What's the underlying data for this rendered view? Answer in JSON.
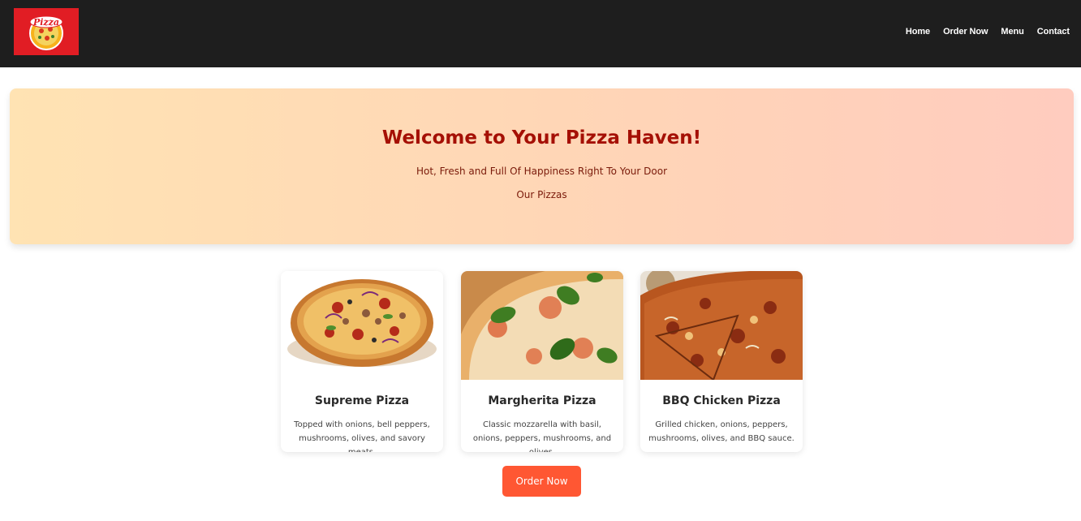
{
  "nav": {
    "logo_text": "Pizza",
    "links": [
      "Home",
      "Order Now",
      "Menu",
      "Contact"
    ]
  },
  "hero": {
    "title": "Welcome to Your Pizza Haven!",
    "subtitle": "Hot, Fresh and Full Of Happiness Right To Your Door",
    "section_label": "Our Pizzas"
  },
  "pizzas": [
    {
      "name": "Supreme Pizza",
      "description": "Topped with onions, bell peppers, mushrooms, olives, and savory meats."
    },
    {
      "name": "Margherita Pizza",
      "description": "Classic mozzarella with basil, onions, peppers, mushrooms, and olives."
    },
    {
      "name": "BBQ Chicken Pizza",
      "description": "Grilled chicken, onions, peppers, mushrooms, olives, and BBQ sauce."
    }
  ],
  "order_button_label": "Order Now",
  "colors": {
    "navbar": "#1e1e1e",
    "logo_bg": "#e11d24",
    "hero_title": "#a51005",
    "button": "#ff5733"
  }
}
